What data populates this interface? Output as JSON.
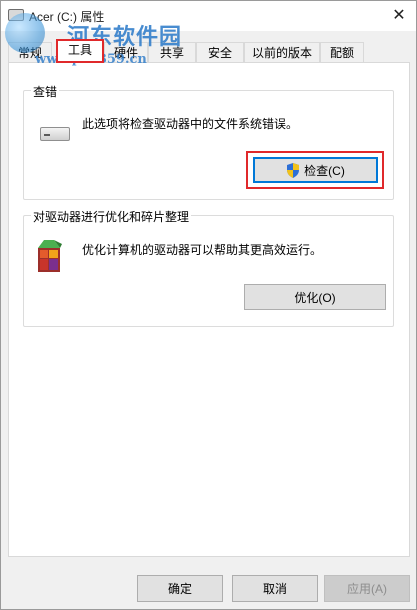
{
  "window": {
    "title": "Acer (C:) 属性",
    "close_glyph": "✕"
  },
  "watermark": {
    "site_name": "河东软件园",
    "url": "www.pc0359.cn"
  },
  "tabs": [
    {
      "label": "常规"
    },
    {
      "label": "工具"
    },
    {
      "label": "硬件"
    },
    {
      "label": "共享"
    },
    {
      "label": "安全"
    },
    {
      "label": "以前的版本"
    },
    {
      "label": "配额"
    }
  ],
  "active_tab": "工具",
  "error_check": {
    "title": "查错",
    "description": "此选项将检查驱动器中的文件系统错误。",
    "button": "检查(C)",
    "icon": "drive-icon"
  },
  "optimize": {
    "title": "对驱动器进行优化和碎片整理",
    "description": "优化计算机的驱动器可以帮助其更高效运行。",
    "button": "优化(O)",
    "icon": "defrag-icon"
  },
  "footer": {
    "ok": "确定",
    "cancel": "取消",
    "apply": "应用(A)"
  },
  "colors": {
    "highlight_box": "#e0292b",
    "default_button_border": "#0078d7"
  }
}
